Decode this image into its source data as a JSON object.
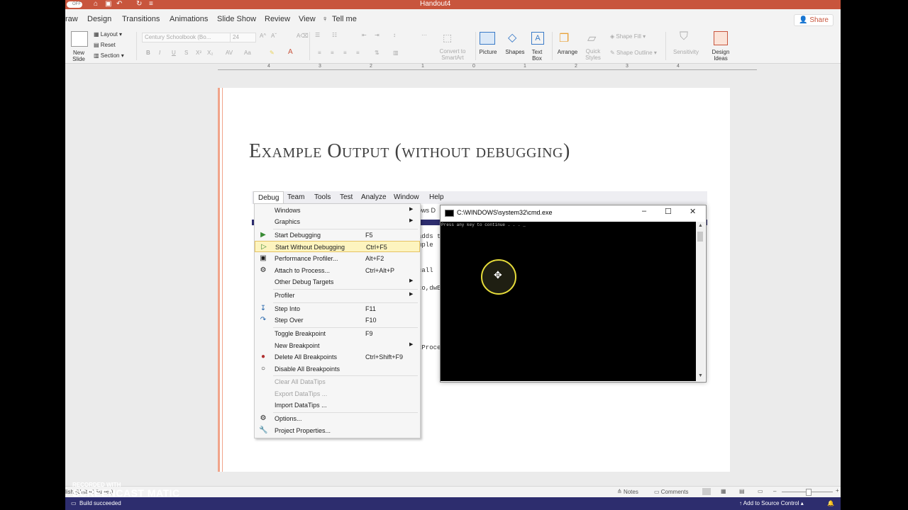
{
  "window": {
    "title": "Handout4",
    "autosave": "OFF"
  },
  "tabs": [
    "raw",
    "Design",
    "Transitions",
    "Animations",
    "Slide Show",
    "Review",
    "View",
    "Tell me"
  ],
  "share_label": "Share",
  "ribbon": {
    "new_slide": "New\nSlide",
    "layout": "Layout",
    "reset": "Reset",
    "section": "Section",
    "font_name": "Century Schoolbook (Bo...",
    "font_size": "24",
    "convert": "Convert to\nSmartArt",
    "picture": "Picture",
    "shapes": "Shapes",
    "text_box": "Text\nBox",
    "arrange": "Arrange",
    "quick_styles": "Quick\nStyles",
    "shape_fill": "Shape Fill",
    "shape_outline": "Shape Outline",
    "sensitivity": "Sensitivity",
    "design_ideas": "Design\nIdeas"
  },
  "ruler_ticks": [
    "4",
    "3",
    "2",
    "1",
    "0",
    "1",
    "2",
    "3",
    "4"
  ],
  "slide": {
    "title": "Example Output (without debugging)"
  },
  "vs_menu": [
    "Debug",
    "Team",
    "Tools",
    "Test",
    "Analyze",
    "Window",
    "Help"
  ],
  "vs_code": {
    "line1": "adds t",
    "line2": "mple",
    "line3": "call",
    "line4": "to,dwE",
    "line5": "tProce",
    "tab_fragment": "ows D"
  },
  "debug_menu": {
    "items": [
      {
        "label": "Windows",
        "shortcut": "",
        "arrow": true,
        "icon": ""
      },
      {
        "label": "Graphics",
        "shortcut": "",
        "arrow": true,
        "icon": ""
      },
      {
        "label": "Start Debugging",
        "shortcut": "F5",
        "arrow": false,
        "icon": "play-icon"
      },
      {
        "label": "Start Without Debugging",
        "shortcut": "Ctrl+F5",
        "arrow": false,
        "icon": "play-outline-icon"
      },
      {
        "label": "Performance Profiler...",
        "shortcut": "Alt+F2",
        "arrow": false,
        "icon": "profiler-icon"
      },
      {
        "label": "Attach to Process...",
        "shortcut": "Ctrl+Alt+P",
        "arrow": false,
        "icon": "attach-icon"
      },
      {
        "label": "Other Debug Targets",
        "shortcut": "",
        "arrow": true,
        "icon": ""
      },
      {
        "label": "Profiler",
        "shortcut": "",
        "arrow": true,
        "icon": ""
      },
      {
        "label": "Step Into",
        "shortcut": "F11",
        "arrow": false,
        "icon": "step-into-icon"
      },
      {
        "label": "Step Over",
        "shortcut": "F10",
        "arrow": false,
        "icon": "step-over-icon"
      },
      {
        "label": "Toggle Breakpoint",
        "shortcut": "F9",
        "arrow": false,
        "icon": ""
      },
      {
        "label": "New Breakpoint",
        "shortcut": "",
        "arrow": true,
        "icon": ""
      },
      {
        "label": "Delete All Breakpoints",
        "shortcut": "Ctrl+Shift+F9",
        "arrow": false,
        "icon": "delete-breakpoints-icon"
      },
      {
        "label": "Disable All Breakpoints",
        "shortcut": "",
        "arrow": false,
        "icon": "disable-breakpoints-icon"
      },
      {
        "label": "Clear All DataTips",
        "shortcut": "",
        "arrow": false,
        "icon": ""
      },
      {
        "label": "Export DataTips ...",
        "shortcut": "",
        "arrow": false,
        "icon": ""
      },
      {
        "label": "Import DataTips ...",
        "shortcut": "",
        "arrow": false,
        "icon": ""
      },
      {
        "label": "Options...",
        "shortcut": "",
        "arrow": false,
        "icon": "gear-icon"
      },
      {
        "label": "Project Properties...",
        "shortcut": "",
        "arrow": false,
        "icon": "wrench-icon"
      }
    ]
  },
  "cmd": {
    "title": "C:\\WINDOWS\\system32\\cmd.exe",
    "output": "Press any key to continue . . . _"
  },
  "statusbar": {
    "notes": "Notes",
    "comments": "Comments",
    "language": "lish (United States)"
  },
  "vs_status": {
    "build": "Build succeeded",
    "source_control": "Add to Source Control"
  },
  "watermark": {
    "small": "RECORDED WITH",
    "big": "SCREENCAST  MATIC"
  },
  "colors": {
    "accent": "#c8553d",
    "vs_status": "#2d2d6e",
    "highlight": "#fdf4bf",
    "slide_stripe": "#f0a48a"
  }
}
